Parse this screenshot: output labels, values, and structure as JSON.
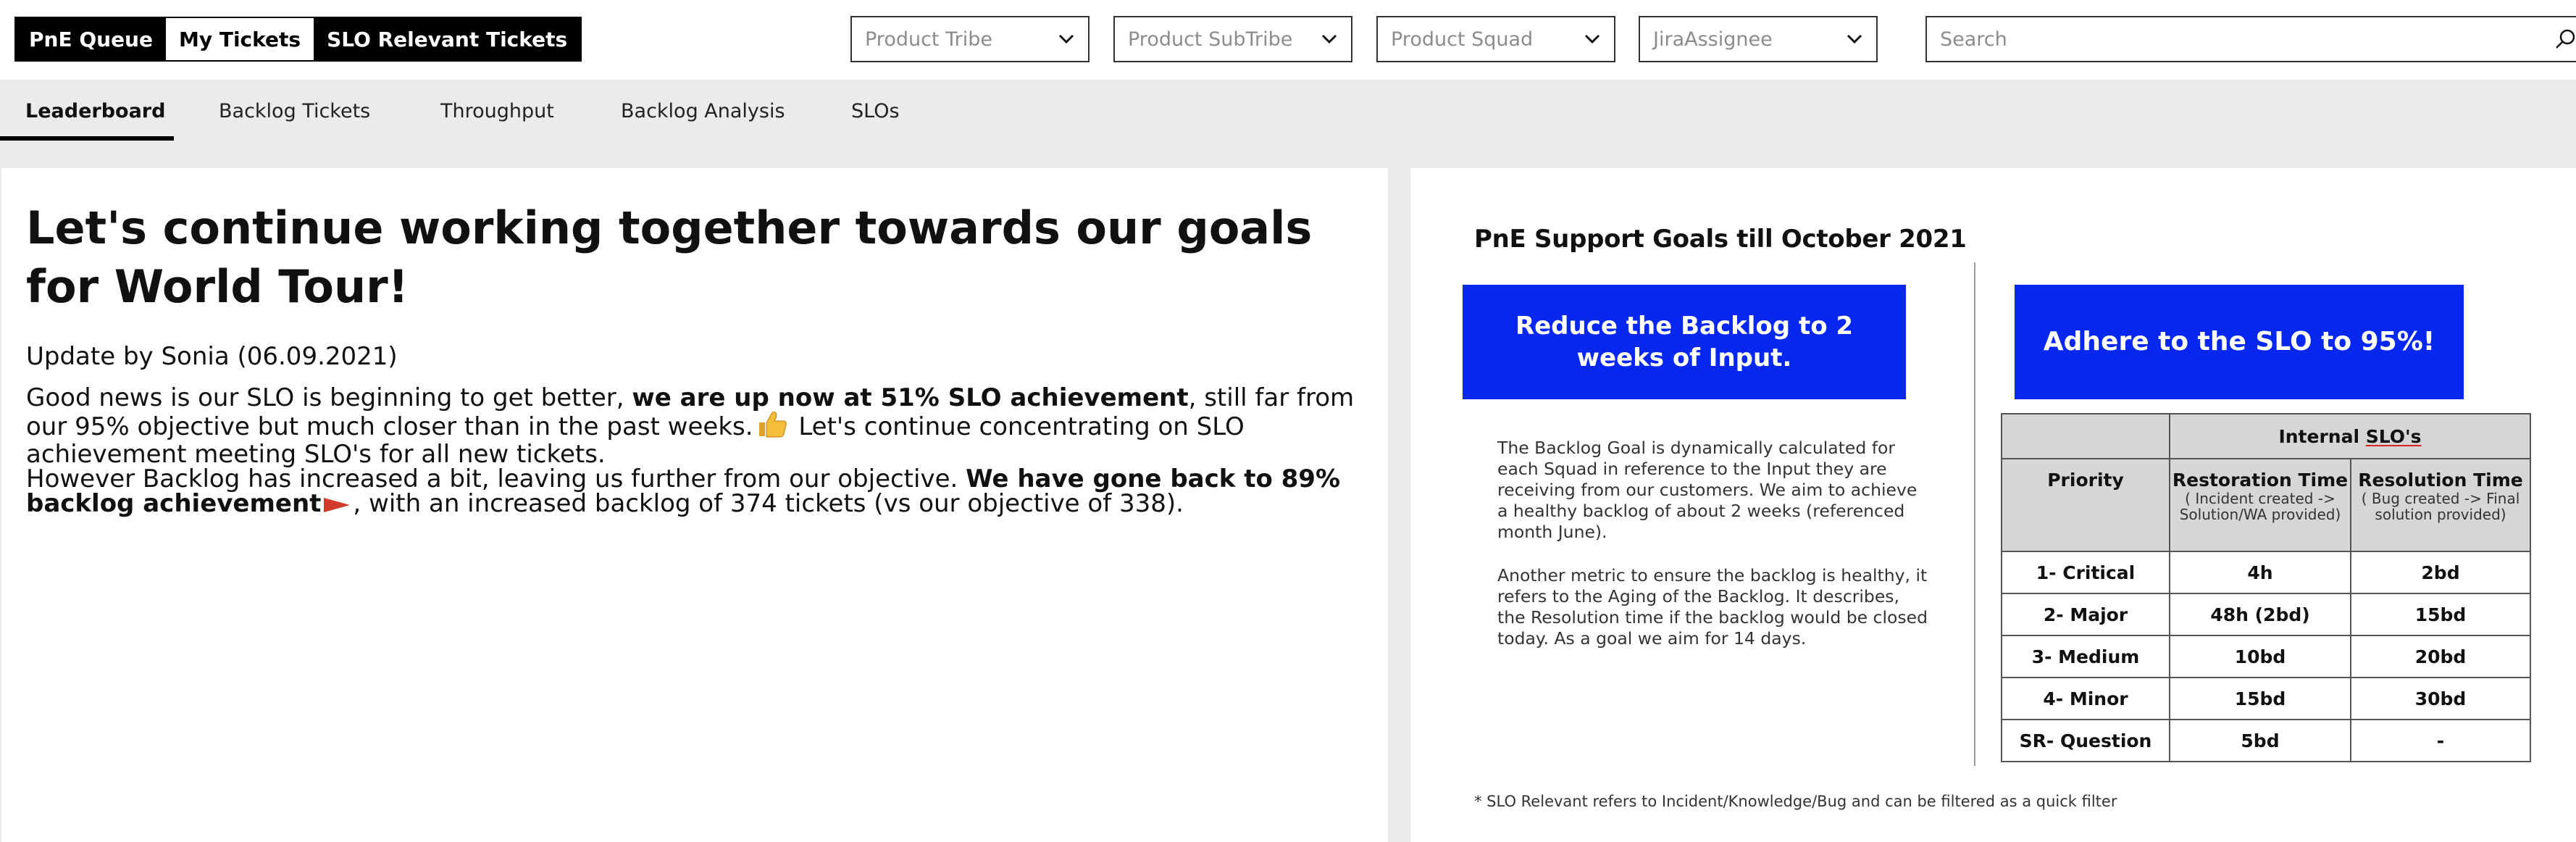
{
  "queue_tabs": [
    {
      "label": "PnE Queue"
    },
    {
      "label": "My Tickets"
    },
    {
      "label": "SLO Relevant Tickets"
    }
  ],
  "filters": [
    {
      "label": "Product Tribe"
    },
    {
      "label": "Product SubTribe"
    },
    {
      "label": "Product Squad"
    },
    {
      "label": "JiraAssignee"
    }
  ],
  "search": {
    "placeholder": "Search",
    "icon": "search-icon"
  },
  "nav_tabs": [
    {
      "label": "Leaderboard",
      "active": true
    },
    {
      "label": "Backlog Tickets"
    },
    {
      "label": "Throughput"
    },
    {
      "label": "Backlog Analysis"
    },
    {
      "label": "SLOs"
    }
  ],
  "left": {
    "headline": "Let's continue working together towards our goals for World Tour!",
    "update": "Update by Sonia (06.09.2021)",
    "p1_a": "Good news is our SLO is beginning to get better, ",
    "p1_b": "we are up now at 51% SLO achievement",
    "p1_c": ", still far from our 95% objective but much closer than in the past weeks.",
    "p1_d": " Let's continue concentrating on SLO achievement meeting SLO's for all new tickets.",
    "p2_a": "However Backlog has increased a bit, leaving us further from our objective. ",
    "p2_b": "We have gone back to 89% backlog achievement",
    "p2_c": ", with an increased backlog of 374 tickets (vs our objective of 338).",
    "thumb_icon": "thumbs-up-icon",
    "flag_icon": "red-triangle-flag-icon"
  },
  "right": {
    "title": "PnE Support Goals till October 2021",
    "goal_backlog": "Reduce the Backlog to 2 weeks of Input.",
    "goal_slo": "Adhere to the SLO to 95%!",
    "para1": "The Backlog Goal is dynamically calculated for each Squad in reference to the Input they are receiving from our customers. We aim to achieve a healthy backlog of about 2 weeks (referenced month June).",
    "para2": "Another metric to ensure the backlog is healthy, it refers to the Aging of the Backlog. It describes, the Resolution time if the backlog would be closed today. As a goal we aim for 14 days.",
    "table": {
      "group_header_a": "Internal ",
      "group_header_b": "SLO's",
      "col_priority": "Priority",
      "col_restoration": "Restoration Time",
      "col_restoration_sub": "( Incident created -> Solution/WA provided)",
      "col_resolution": "Resolution Time",
      "col_resolution_sub": "( Bug created -> Final solution provided)",
      "rows": [
        {
          "priority": "1- Critical",
          "restoration": "4h",
          "resolution": "2bd"
        },
        {
          "priority": "2- Major",
          "restoration": "48h (2bd)",
          "resolution": "15bd"
        },
        {
          "priority": "3- Medium",
          "restoration": "10bd",
          "resolution": "20bd"
        },
        {
          "priority": "4- Minor",
          "restoration": "15bd",
          "resolution": "30bd"
        },
        {
          "priority": "SR- Question",
          "restoration": "5bd",
          "resolution": "-"
        }
      ]
    },
    "footnote": "* SLO Relevant refers to Incident/Knowledge/Bug and can be filtered as a quick filter"
  },
  "colors": {
    "goal_blue": "#0527f0",
    "table_header_grey": "#d6d6d6",
    "flag_red": "#d23a2a"
  }
}
